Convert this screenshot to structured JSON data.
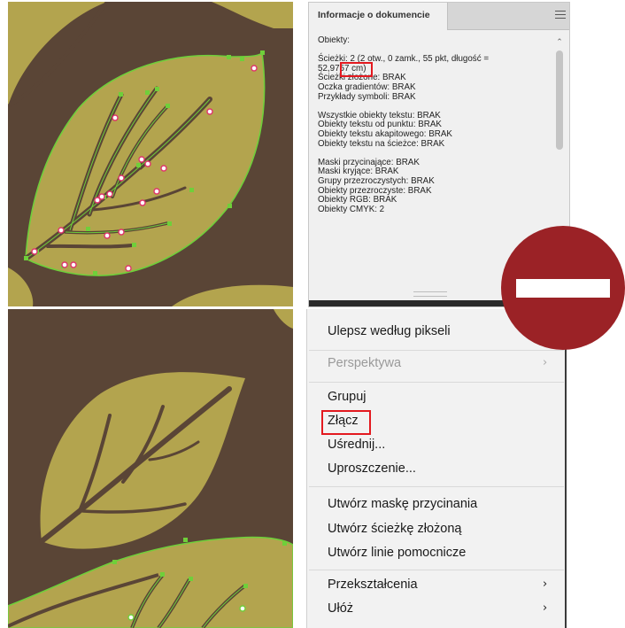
{
  "panel": {
    "tab_title": "Informacje o dokumencie",
    "lines": [
      "Obiekty:",
      "",
      "Ścieżki: 2 (2 otw., 0 zamk., 55 pkt, długość =",
      "52,9757 cm)",
      "Ścieżki złożone: BRAK",
      "Oczka gradientów: BRAK",
      "Przykłady symboli: BRAK",
      "",
      "Wszystkie obiekty tekstu: BRAK",
      "Obiekty tekstu od punktu: BRAK",
      "Obiekty tekstu akapitowego: BRAK",
      "Obiekty tekstu na ścieżce: BRAK",
      "",
      "Maski przycinające: BRAK",
      "Maski kryjące: BRAK",
      "Grupy przezroczystych: BRAK",
      "Obiekty przezroczyste: BRAK",
      "Obiekty RGB: BRAK",
      "Obiekty CMYK: 2"
    ]
  },
  "menu": {
    "items": [
      {
        "label": "Ulepsz według pikseli",
        "disabled": false
      },
      {
        "label": "Perspektywa",
        "disabled": true,
        "submenu": true
      },
      {
        "label": "Grupuj",
        "disabled": false
      },
      {
        "label": "Złącz",
        "disabled": false,
        "highlighted": true
      },
      {
        "label": "Uśrednij...",
        "disabled": false
      },
      {
        "label": "Uproszczenie...",
        "disabled": false
      },
      {
        "label": "Utwórz maskę przycinania",
        "disabled": false
      },
      {
        "label": "Utwórz ścieżkę złożoną",
        "disabled": false
      },
      {
        "label": "Utwórz linie pomocnicze",
        "disabled": false
      },
      {
        "label": "Przekształcenia",
        "disabled": false,
        "submenu": true
      },
      {
        "label": "Ułóż",
        "disabled": false,
        "submenu": true
      }
    ],
    "submenu_arrow": "›"
  },
  "colors": {
    "background_brown": "#5a4536",
    "leaf_olive": "#b3a44e",
    "path_green": "#6fcf3a",
    "highlight_red": "#e3191f",
    "no_entry_red": "#9b2226"
  },
  "icons": {
    "panel_menu": "hamburger-icon",
    "scroll_up": "chevron-up-icon",
    "no_entry": "no-entry-icon",
    "submenu": "chevron-right-icon"
  }
}
